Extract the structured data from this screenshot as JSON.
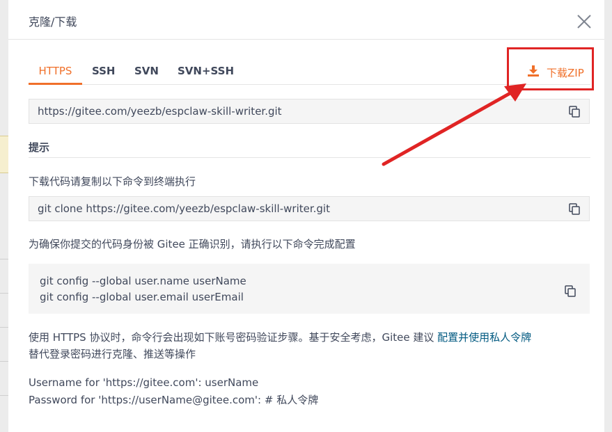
{
  "modal": {
    "title": "克隆/下载"
  },
  "tabs": [
    {
      "label": "HTTPS",
      "active": true
    },
    {
      "label": "SSH",
      "active": false
    },
    {
      "label": "SVN",
      "active": false
    },
    {
      "label": "SVN+SSH",
      "active": false
    }
  ],
  "download": {
    "label": "下载ZIP",
    "icon": "download-icon"
  },
  "repo_url": "https://gitee.com/yeezb/espclaw-skill-writer.git",
  "hint": {
    "title": "提示",
    "clone_instruction": "下载代码请复制以下命令到终端执行",
    "clone_command": "git clone https://gitee.com/yeezb/espclaw-skill-writer.git",
    "config_instruction": "为确保你提交的代码身份被 Gitee 正确识别，请执行以下命令完成配置",
    "config_lines": [
      "git config --global user.name userName",
      "git config --global user.email userEmail"
    ],
    "https_note_prefix": "使用 HTTPS 协议时，命令行会出现如下账号密码验证步骤。基于安全考虑，Gitee 建议 ",
    "https_note_link": "配置并使用私人令牌",
    "https_note_suffix": "替代登录密码进行克隆、推送等操作",
    "username_line": "Username for 'https://gitee.com': userName",
    "password_line": "Password for 'https://userName@gitee.com': # 私人令牌"
  },
  "colors": {
    "accent": "#f0702a",
    "annotation_red": "#e02424",
    "link": "#005980",
    "text": "#40485b"
  }
}
